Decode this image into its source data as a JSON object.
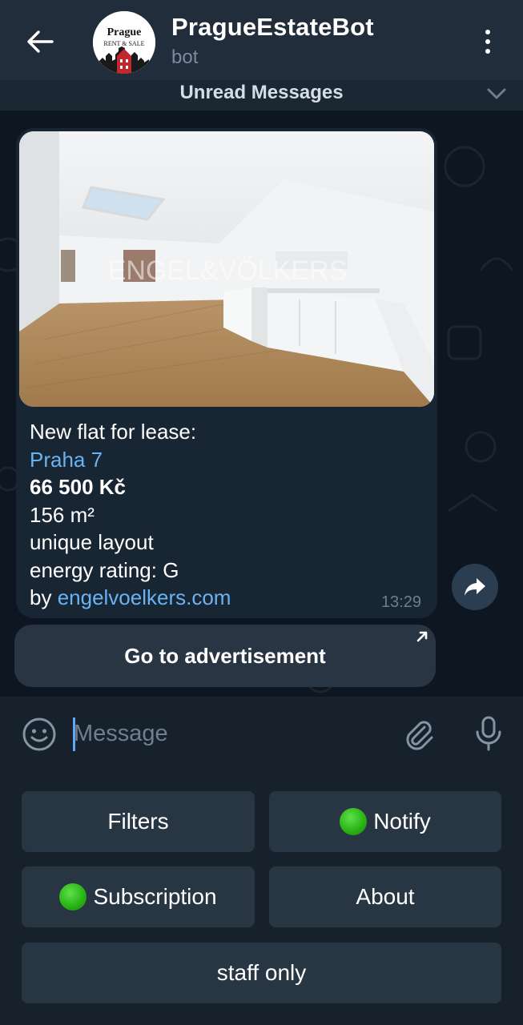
{
  "header": {
    "title": "PragueEstateBot",
    "subtitle": "bot",
    "avatar_text_top": "Prague",
    "avatar_text_bottom": "Rent & Sale"
  },
  "unread_bar": {
    "label": "Unread Messages"
  },
  "message": {
    "photo_watermark": "ENGEL&VÖLKERS",
    "intro": "New flat for lease:",
    "district": "Praha 7",
    "price": "66 500 Kč",
    "area": "156  m²",
    "layout": "unique layout",
    "energy": "energy rating: G",
    "by_prefix": "by ",
    "source_link": "engelvoelkers.com",
    "time": "13:29"
  },
  "inline_button": {
    "label": "Go to advertisement"
  },
  "composer": {
    "placeholder": "Message"
  },
  "keyboard": {
    "filters": "Filters",
    "notify": "Notify",
    "subscription": "Subscription",
    "about": "About",
    "staff_only": "staff only"
  },
  "colors": {
    "accent_link": "#6ab3f3",
    "status_dot": "#2bb516",
    "header_bg": "#212d3b",
    "bubble_bg": "#182533"
  }
}
